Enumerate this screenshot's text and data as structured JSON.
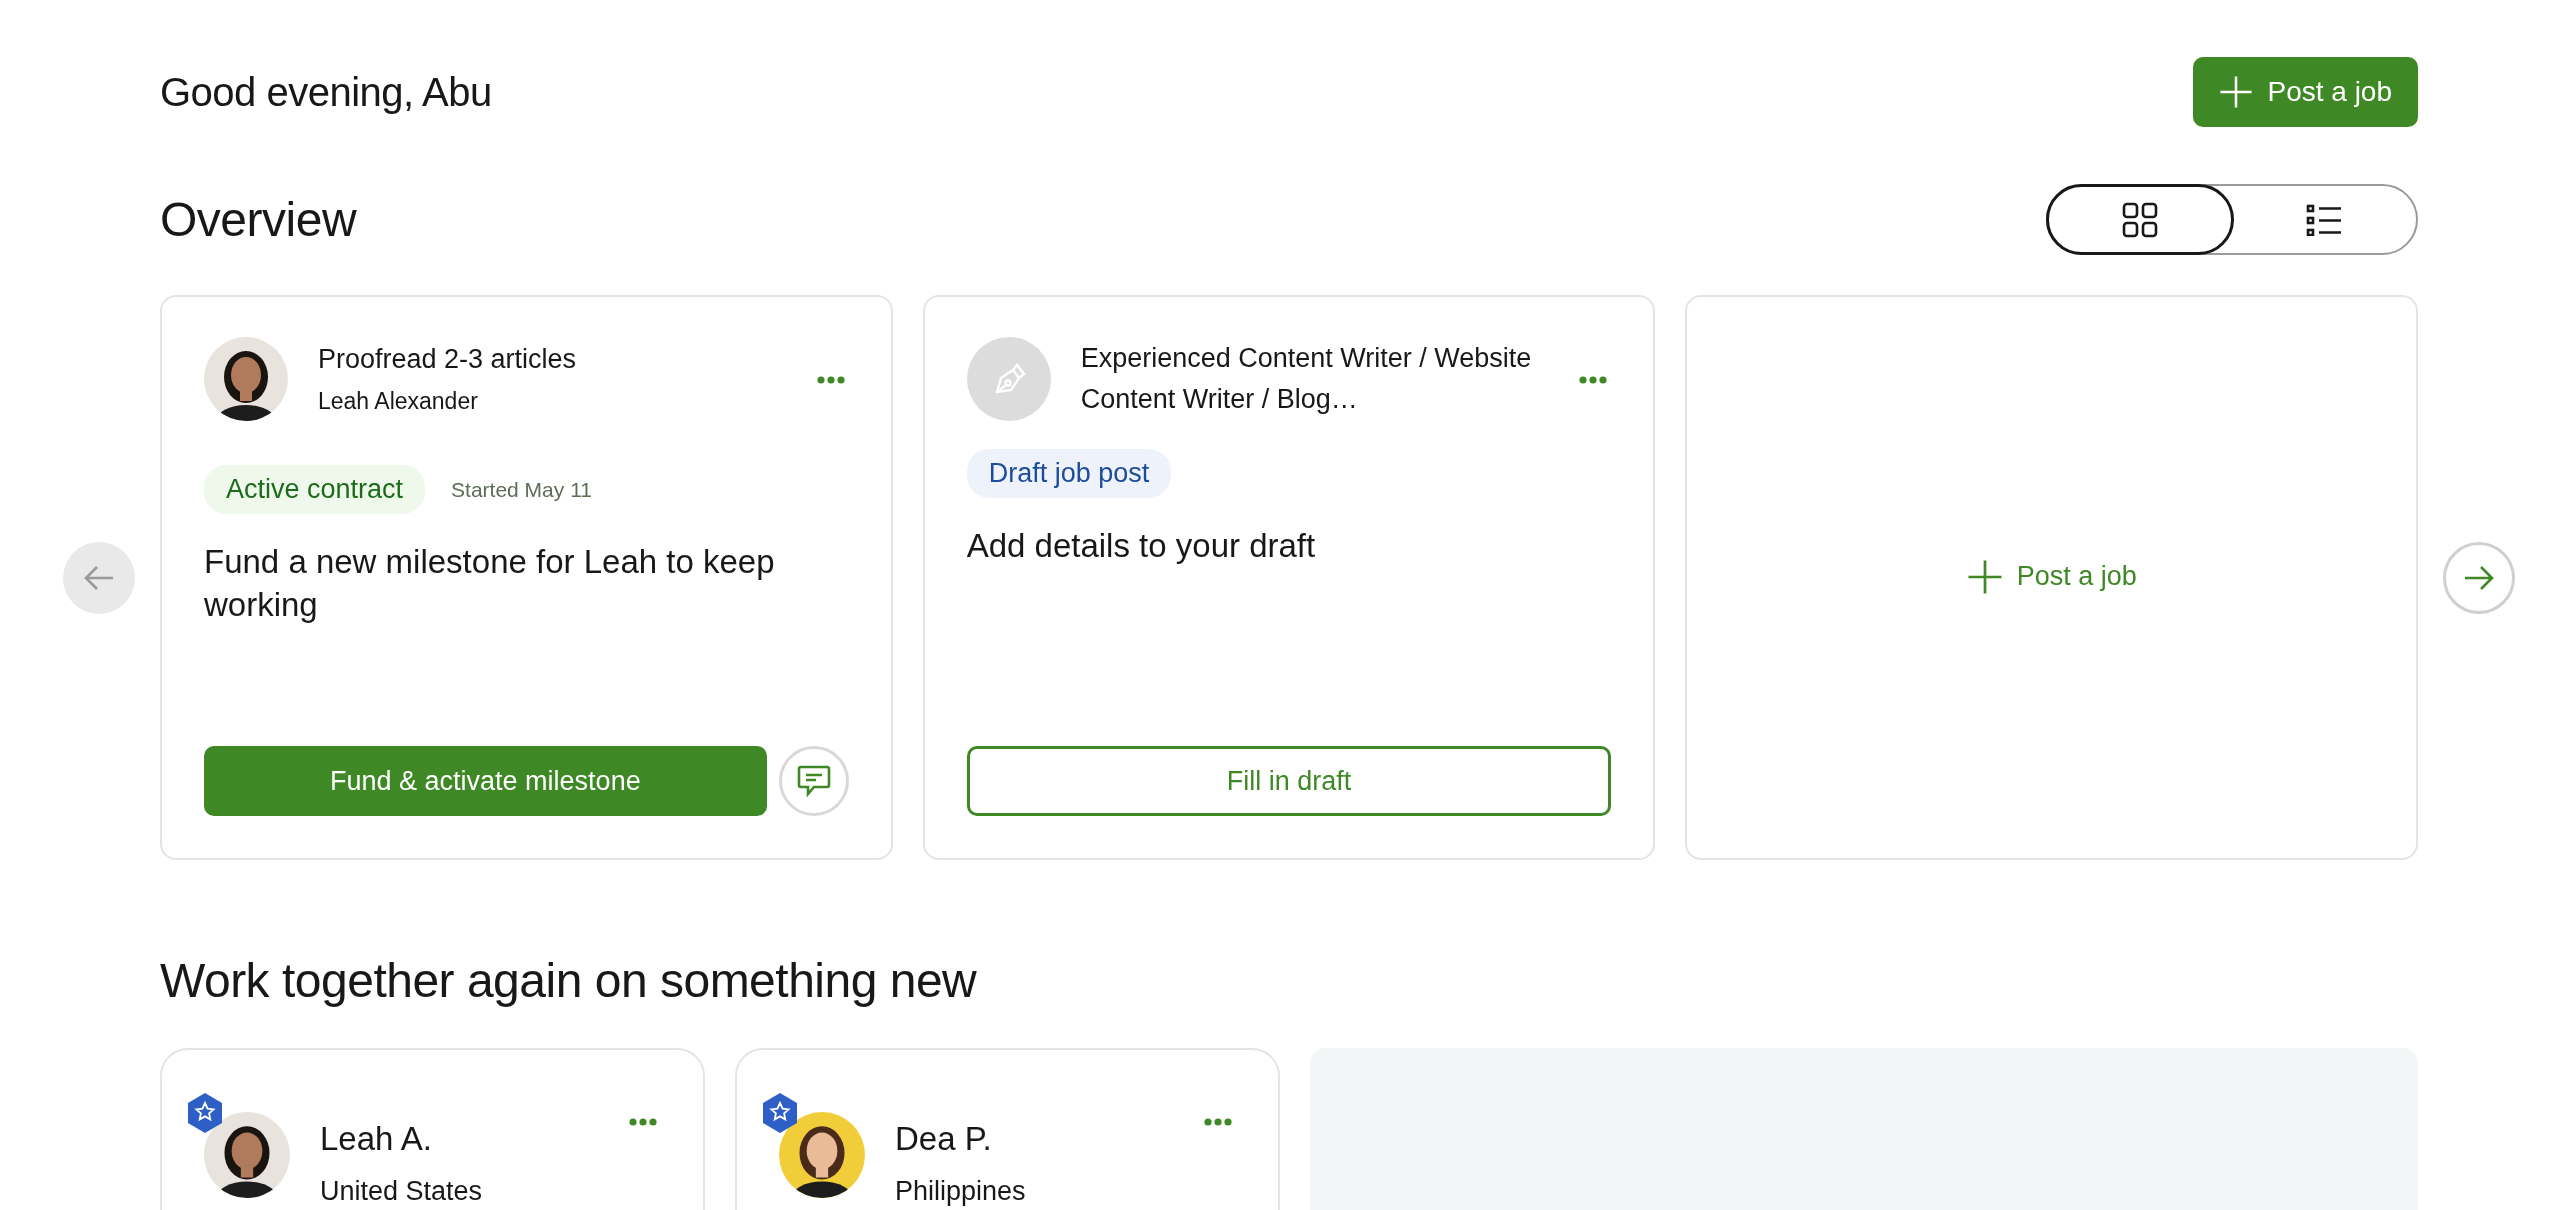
{
  "greeting": "Good evening, Abu",
  "post_job_button": {
    "label": "Post a job"
  },
  "overview": {
    "title": "Overview",
    "view_toggle": [
      {
        "kind": "grid",
        "selected": true
      },
      {
        "kind": "list",
        "selected": false
      }
    ],
    "carousel": {
      "prev": {
        "disabled": true
      },
      "next": {
        "disabled": false
      }
    },
    "cards": [
      {
        "kind": "contract",
        "title": "Proofread 2-3 articles",
        "subtitle": "Leah Alexander",
        "tag": "Active contract",
        "meta": "Started May 11",
        "message": "Fund a new milestone for Leah to keep working",
        "action": "Fund & activate milestone"
      },
      {
        "kind": "draft",
        "title": "Experienced Content Writer / Website Content Writer / Blog…",
        "tag": "Draft job post",
        "message": "Add details to your draft",
        "action": "Fill in draft"
      },
      {
        "kind": "new",
        "label": "Post a job"
      }
    ]
  },
  "work_again": {
    "title": "Work together again on something new",
    "freelancers": [
      {
        "name": "Leah A.",
        "location": "United States",
        "top_rated": true
      },
      {
        "name": "Dea P.",
        "location": "Philippines",
        "top_rated": true
      }
    ]
  }
}
